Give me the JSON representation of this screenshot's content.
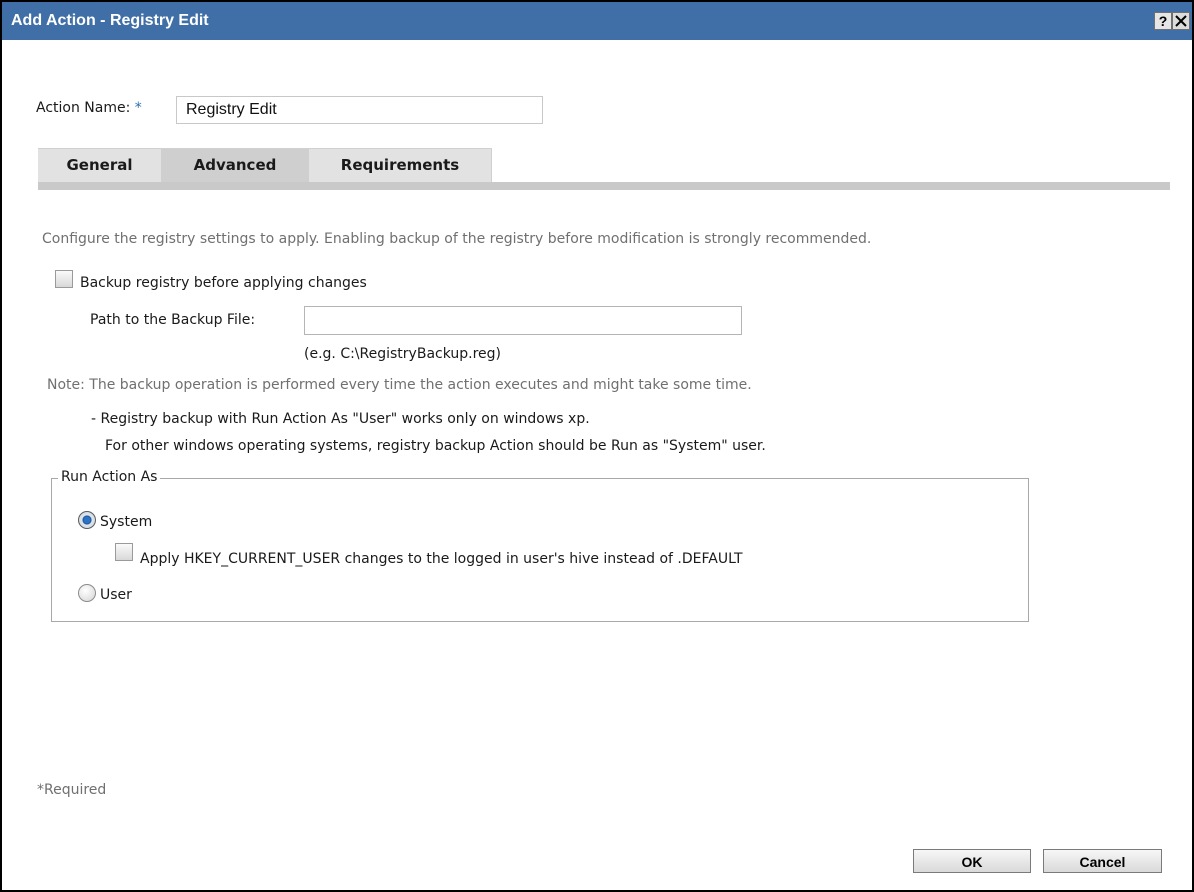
{
  "window": {
    "title": "Add Action - Registry Edit",
    "help_label": "?"
  },
  "action_name": {
    "label": "Action Name:",
    "required_marker": "*",
    "value": "Registry Edit"
  },
  "tabs": [
    {
      "label": "General",
      "selected": false
    },
    {
      "label": "Advanced",
      "selected": true
    },
    {
      "label": "Requirements",
      "selected": false
    }
  ],
  "advanced": {
    "description": "Configure the registry settings to apply. Enabling backup of the registry before modification is strongly recommended.",
    "backup_checkbox": {
      "label": "Backup registry before applying changes",
      "checked": false
    },
    "path_field": {
      "label": "Path to the Backup File:",
      "value": "",
      "example": "(e.g. C:\\RegistryBackup.reg)"
    },
    "note_line1": "Note: The backup operation is performed every time the action executes and might take some time.",
    "note_line2": "- Registry backup with Run Action As \"User\" works only on windows xp.",
    "note_line3": "For other windows operating systems, registry backup Action should be Run as \"System\" user.",
    "run_as": {
      "legend": "Run Action As",
      "options": [
        {
          "label": "System",
          "selected": true
        },
        {
          "label": "User",
          "selected": false
        }
      ],
      "hkey_checkbox": {
        "label": "Apply HKEY_CURRENT_USER changes to the logged in user's hive instead of .DEFAULT",
        "checked": false
      }
    }
  },
  "required_note": "*Required",
  "buttons": {
    "ok": "OK",
    "cancel": "Cancel"
  },
  "colors": {
    "titlebar": "#3f6fa6",
    "required_marker": "#2a6fb0",
    "muted_text": "#707070"
  }
}
